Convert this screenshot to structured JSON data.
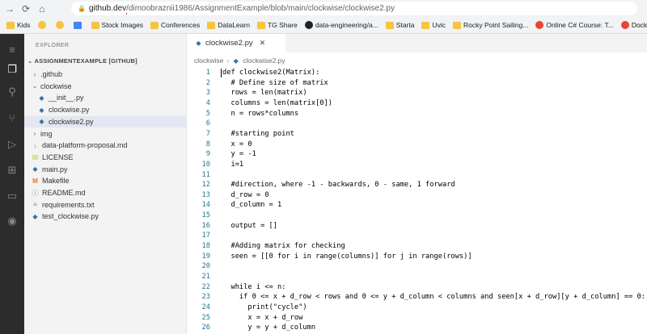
{
  "browser": {
    "url_host": "github.dev",
    "url_path": "/dimoobraznii1986/AssignmentExample/blob/main/clockwise/clockwise2.py",
    "bookmarks": [
      {
        "label": "Kids",
        "icon": "folder-icon"
      },
      {
        "label": "",
        "icon": "emoji-icon"
      },
      {
        "label": "",
        "icon": "emoji-icon"
      },
      {
        "label": "",
        "icon": "bookmark-icon"
      },
      {
        "label": "Stock Images",
        "icon": "folder-icon"
      },
      {
        "label": "Conferences",
        "icon": "folder-icon"
      },
      {
        "label": "DataLearn",
        "icon": "folder-icon"
      },
      {
        "label": "TG Share",
        "icon": "folder-icon"
      },
      {
        "label": "data-engineering/a...",
        "icon": "github-icon"
      },
      {
        "label": "Starta",
        "icon": "folder-icon"
      },
      {
        "label": "Uvic",
        "icon": "folder-icon"
      },
      {
        "label": "Rocky Point Sailing...",
        "icon": "folder-icon"
      },
      {
        "label": "Online C# Course: T...",
        "icon": "site-icon"
      },
      {
        "label": "Docke",
        "icon": "site-icon"
      }
    ]
  },
  "explorer": {
    "title": "EXPLORER",
    "repo": "ASSIGNMENTEXAMPLE [GITHUB]",
    "items": [
      {
        "label": ".github",
        "type": "folder",
        "depth": 1,
        "open": false
      },
      {
        "label": "clockwise",
        "type": "folder",
        "depth": 1,
        "open": true
      },
      {
        "label": "__init__.py",
        "type": "py",
        "depth": 2
      },
      {
        "label": "clockwise.py",
        "type": "py",
        "depth": 2
      },
      {
        "label": "clockwise2.py",
        "type": "py",
        "depth": 2,
        "selected": true
      },
      {
        "label": "img",
        "type": "folder",
        "depth": 1,
        "open": false
      },
      {
        "label": "data-platform-proposal.md",
        "type": "md",
        "depth": 1
      },
      {
        "label": "LICENSE",
        "type": "lic",
        "depth": 1
      },
      {
        "label": "main.py",
        "type": "py",
        "depth": 1
      },
      {
        "label": "Makefile",
        "type": "mk",
        "depth": 1
      },
      {
        "label": "README.md",
        "type": "info",
        "depth": 1
      },
      {
        "label": "requirements.txt",
        "type": "txt",
        "depth": 1
      },
      {
        "label": "test_clockwise.py",
        "type": "py",
        "depth": 1
      }
    ]
  },
  "editor": {
    "tab_label": "clockwise2.py",
    "breadcrumb": {
      "folder": "clockwise",
      "file": "clockwise2.py"
    },
    "lines": [
      "def clockwise2(Matrix):",
      "  # Define size of matrix",
      "  rows = len(matrix)",
      "  columns = len(matrix[0])",
      "  n = rows*columns",
      "",
      "  #starting point",
      "  x = 0",
      "  y = -1",
      "  i=1",
      "",
      "  #direction, where -1 - backwards, 0 - same, 1 forward",
      "  d_row = 0",
      "  d_column = 1",
      "",
      "  output = []",
      "",
      "  #Adding matrix for checking",
      "  seen = [[0 for i in range(columns)] for j in range(rows)]",
      "",
      "",
      "  while i <= n:",
      "    if 0 <= x + d_row < rows and 0 <= y + d_column < columns and seen[x + d_row][y + d_column] == 0:",
      "      print(\"cycle\")",
      "      x = x + d_row",
      "      y = y + d_column"
    ],
    "current_line": 1
  },
  "colors": {
    "activity_bar": "#2c2c2c",
    "sidebar": "#f3f3f3",
    "line_number": "#237893",
    "selection": "#e4e6f1"
  }
}
